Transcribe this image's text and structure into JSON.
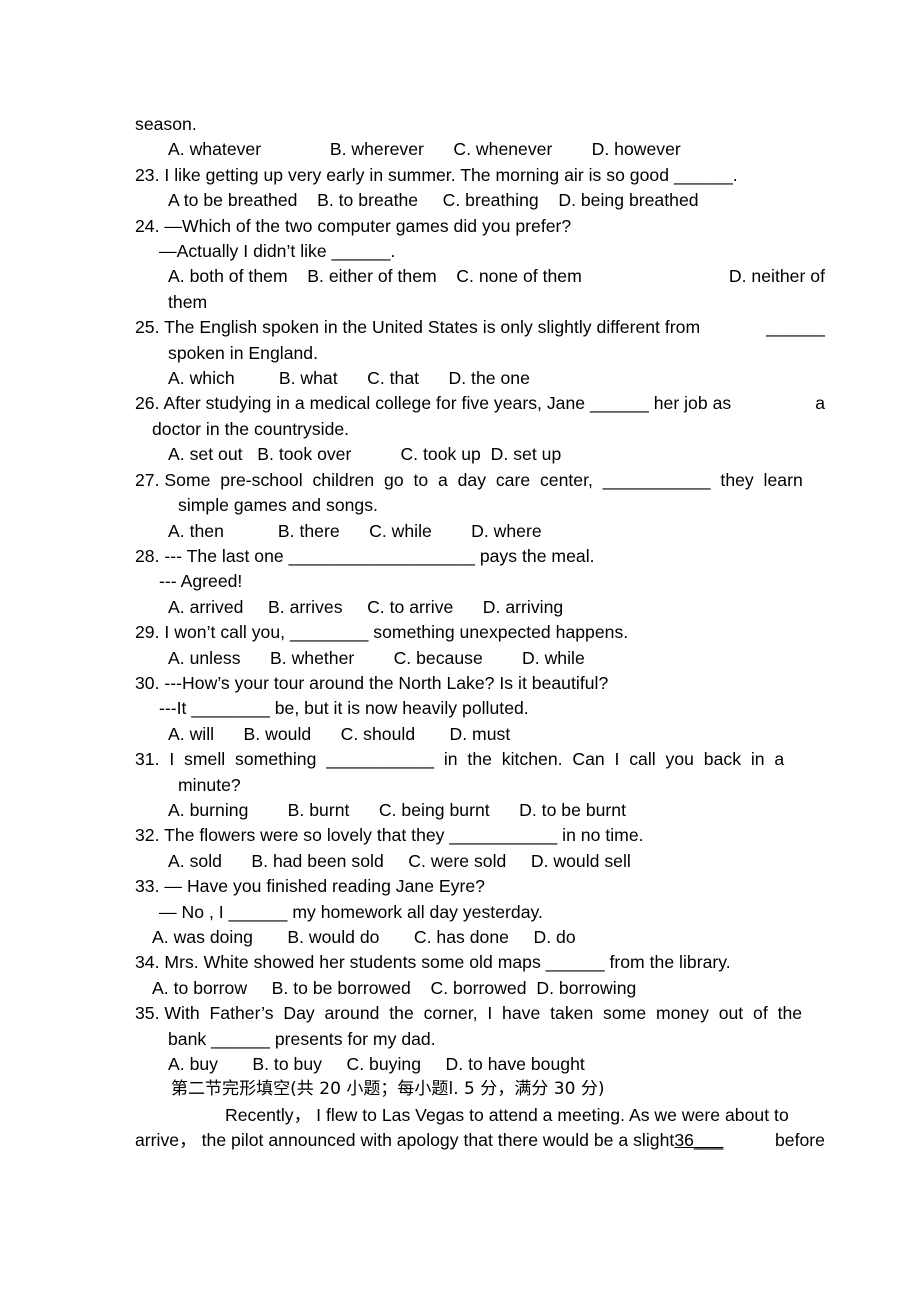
{
  "document": {
    "type": "english-exam-paper",
    "page_background": "#ffffff",
    "text_color": "#000000",
    "carryover_line": "season.",
    "questions": [
      {
        "number": "22",
        "carryover": true,
        "stem_lines": [],
        "options_line": "A. whatever              B. wherever      C. whenever        D. however"
      },
      {
        "number": "23",
        "stem_lines": [
          "23. I like getting up very early in summer. The morning air is so good ______."
        ],
        "options_line": "A to be breathed    B. to breathe     C. breathing    D. being breathed"
      },
      {
        "number": "24",
        "stem_lines": [
          "24. —Which of the two computer games did you prefer?",
          "—Actually I didn’t like ______."
        ],
        "options_line_left": "A. both of them    B. either of them    C. none of them",
        "options_line_right": "D. neither of",
        "options_wrap": "them"
      },
      {
        "number": "25",
        "stem_line_left": "25. The English spoken in the United States is only slightly different from",
        "stem_line_right": "______",
        "stem_lines_extra": [
          "spoken in England."
        ],
        "options_line": "A. which         B. what      C. that      D. the one"
      },
      {
        "number": "26",
        "stem_line_left": "26. After studying in a medical college for five years, Jane ______ her job as",
        "stem_line_right": "a",
        "stem_lines_extra": [
          "doctor in the countryside."
        ],
        "options_line": "A. set out   B. took over          C. took up  D. set up"
      },
      {
        "number": "27",
        "stem_line_left": "27. Some  pre-school  children  go  to  a  day  care  center,  ___________  they  learn",
        "stem_line_right": "",
        "stem_lines_extra": [
          "simple games and songs."
        ],
        "options_line": "A. then           B. there      C. while        D. where"
      },
      {
        "number": "28",
        "stem_lines": [
          "28. --- The last one ___________________ pays the meal.",
          "--- Agreed!"
        ],
        "options_line": "A. arrived     B. arrives     C. to arrive      D. arriving"
      },
      {
        "number": "29",
        "stem_lines": [
          "29. I won’t call you, ________ something unexpected happens."
        ],
        "options_line": "A. unless      B. whether        C. because        D. while"
      },
      {
        "number": "30",
        "stem_lines": [
          "30. ---How’s your tour around the North Lake? Is it beautiful?",
          "---It ________ be, but it is now heavily polluted."
        ],
        "options_line": "A. will      B. would      C. should       D. must"
      },
      {
        "number": "31",
        "stem_line_left": "31.  I  smell  something  ___________  in  the  kitchen.  Can  I  call  you  back  in  a",
        "stem_line_right": "",
        "stem_lines_extra": [
          "minute?"
        ],
        "options_line": "A. burning        B. burnt      C. being burnt      D. to be burnt"
      },
      {
        "number": "32",
        "stem_lines": [
          "32. The flowers were so lovely that they ___________ in no time."
        ],
        "options_line": "A. sold      B. had been sold     C. were sold     D. would sell"
      },
      {
        "number": "33",
        "stem_lines": [
          "33. — Have you finished reading Jane Eyre?",
          "— No , I ______ my homework all day yesterday."
        ],
        "options_line": "A. was doing       B. would do       C. has done     D. do"
      },
      {
        "number": "34",
        "stem_lines": [
          "34. Mrs. White showed her students some old maps ______ from the library."
        ],
        "options_line": "A. to borrow     B. to be borrowed    C. borrowed  D. borrowing"
      },
      {
        "number": "35",
        "stem_line_left": "35. With  Father’s  Day  around  the  corner,  I  have  taken  some  money  out  of  the",
        "stem_line_right": "",
        "stem_lines_extra": [
          "bank ______ presents for my dad."
        ],
        "options_line": "A. buy       B. to buy     C. buying     D. to have bought"
      }
    ],
    "section_heading": "第二节完形填空(共 20 小题；每小题l. 5 分，满分 30 分)",
    "passage": {
      "line1_left": "Recently， I flew to Las Vegas to attend a meeting. As we were about to",
      "line1_right": "",
      "line2_left": "arrive， the pilot announced with apology that there would be a slight",
      "line2_blank_number": "36",
      "line2_blank_rule": "___",
      "line2_right": "before"
    }
  }
}
